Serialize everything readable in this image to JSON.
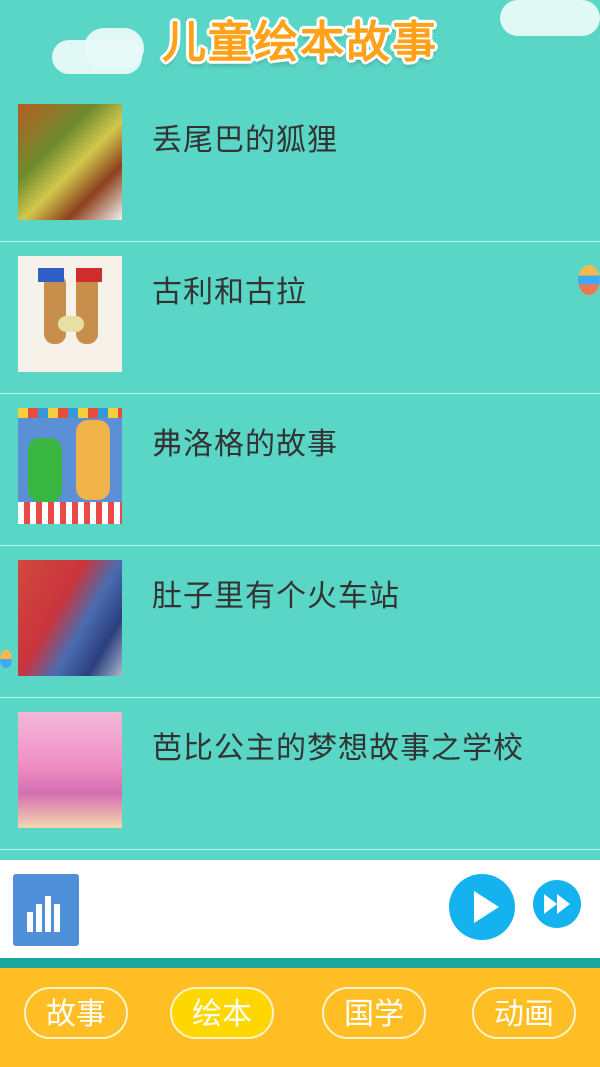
{
  "header": {
    "title": "儿童绘本故事"
  },
  "items": [
    {
      "title": "丢尾巴的狐狸"
    },
    {
      "title": "古利和古拉"
    },
    {
      "title": "弗洛格的故事"
    },
    {
      "title": "肚子里有个火车站"
    },
    {
      "title": "芭比公主的梦想故事之学校"
    }
  ],
  "player": {
    "visualizer_icon": "equalizer-icon",
    "play_icon": "play-icon",
    "next_icon": "fast-forward-icon"
  },
  "tabs": [
    {
      "label": "故事",
      "active": false
    },
    {
      "label": "绘本",
      "active": true
    },
    {
      "label": "国学",
      "active": false
    },
    {
      "label": "动画",
      "active": false
    }
  ],
  "colors": {
    "background": "#5ad6c6",
    "title": "#ffa21a",
    "tabbar": "#ffbf24",
    "active_tab": "#ffd700",
    "play_button": "#14b3ef"
  }
}
